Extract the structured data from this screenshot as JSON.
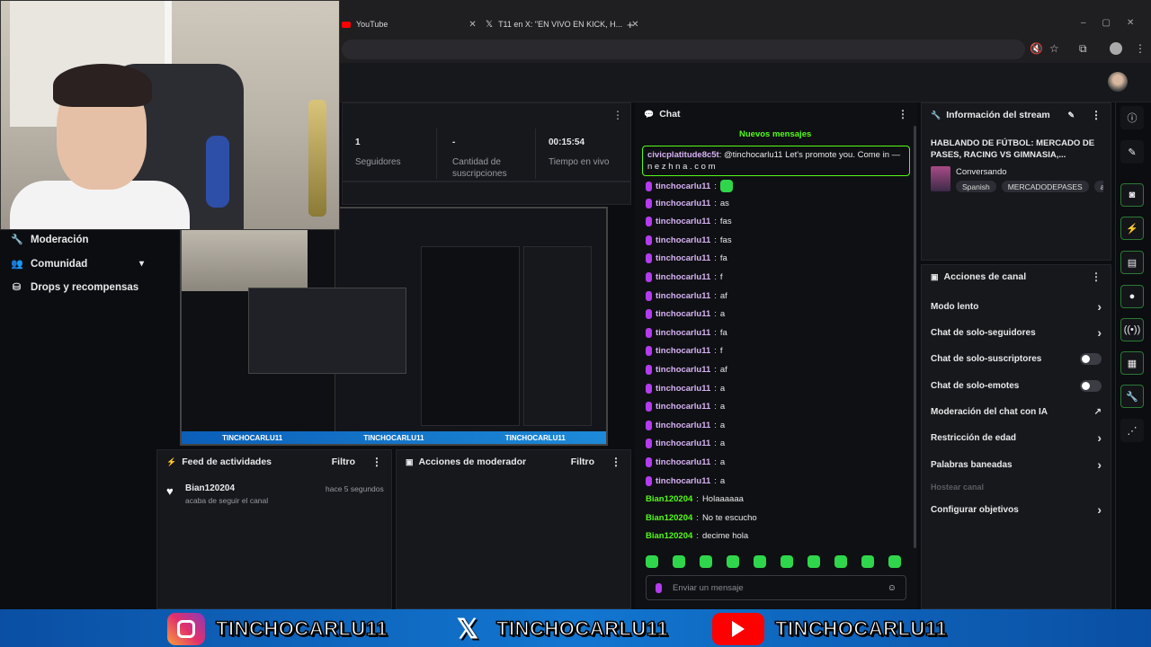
{
  "browser": {
    "tabs": [
      {
        "label": "YouTube"
      },
      {
        "label": "T11 en X: \"EN VIVO EN KICK, H..."
      }
    ],
    "new_tab": "+"
  },
  "stats": [
    {
      "value": "1",
      "label": "Seguidores"
    },
    {
      "value": "-",
      "label": "Cantidad de suscripciones"
    },
    {
      "value": "00:15:54",
      "label": "Tiempo en vivo"
    }
  ],
  "nav": [
    {
      "label": "Moderación",
      "icon": "wrench-icon"
    },
    {
      "label": "Comunidad",
      "icon": "people-icon"
    },
    {
      "label": "Drops y recompensas",
      "icon": "gift-icon"
    }
  ],
  "activity": {
    "title": "Feed de actividades",
    "filter": "Filtro",
    "user": "Bian120204",
    "action": "acaba de seguir el canal",
    "time": "hace 5 segundos"
  },
  "mod_actions": {
    "title": "Acciones de moderador",
    "filter": "Filtro"
  },
  "chat": {
    "title": "Chat",
    "new_messages": "Nuevos mensajes",
    "highlight_user": "civicplatitude8c5t",
    "highlight_text": "@tinchocarlu11 Let's promote you. Come in — n e z h n a . c o m",
    "messages": [
      {
        "user": "tinchocarlu11",
        "text": "",
        "emote": true
      },
      {
        "user": "tinchocarlu11",
        "text": "as"
      },
      {
        "user": "tinchocarlu11",
        "text": "fas"
      },
      {
        "user": "tinchocarlu11",
        "text": "fas"
      },
      {
        "user": "tinchocarlu11",
        "text": "fa"
      },
      {
        "user": "tinchocarlu11",
        "text": "f"
      },
      {
        "user": "tinchocarlu11",
        "text": "af"
      },
      {
        "user": "tinchocarlu11",
        "text": "a"
      },
      {
        "user": "tinchocarlu11",
        "text": "fa"
      },
      {
        "user": "tinchocarlu11",
        "text": "f"
      },
      {
        "user": "tinchocarlu11",
        "text": "af"
      },
      {
        "user": "tinchocarlu11",
        "text": "a"
      },
      {
        "user": "tinchocarlu11",
        "text": "a"
      },
      {
        "user": "tinchocarlu11",
        "text": "a"
      },
      {
        "user": "tinchocarlu11",
        "text": "a"
      },
      {
        "user": "tinchocarlu11",
        "text": "a"
      },
      {
        "user": "tinchocarlu11",
        "text": "a"
      },
      {
        "user": "Bian120204",
        "text": "Holaaaaaa",
        "guest": true
      },
      {
        "user": "Bian120204",
        "text": "No te escucho",
        "guest": true
      },
      {
        "user": "Bian120204",
        "text": "decime hola",
        "guest": true
      }
    ],
    "input_placeholder": "Enviar un mensaje"
  },
  "stream_info": {
    "title": "Información del stream",
    "stream_title": "HABLANDO DE FÚTBOL: MERCADO DE PASES, RACING VS GIMNASIA,...",
    "category": "Conversando",
    "tags": [
      "Spanish",
      "MERCADODEPASES",
      "arge"
    ]
  },
  "channel_actions": {
    "title": "Acciones de canal",
    "items": [
      {
        "label": "Modo lento",
        "control": "chevron"
      },
      {
        "label": "Chat de solo-seguidores",
        "control": "chevron"
      },
      {
        "label": "Chat de solo-suscriptores",
        "control": "toggle"
      },
      {
        "label": "Chat de solo-emotes",
        "control": "toggle"
      },
      {
        "label": "Moderación del chat con IA",
        "control": "external"
      },
      {
        "label": "Restricción de edad",
        "control": "chevron"
      },
      {
        "label": "Palabras baneadas",
        "control": "chevron"
      },
      {
        "label": "Hostear canal",
        "control": "none",
        "disabled": true
      },
      {
        "label": "Configurar objetivos",
        "control": "chevron"
      }
    ]
  },
  "banner": {
    "instagram": "TINCHOCARLU11",
    "x": "TINCHOCARLU11",
    "youtube": "TINCHOCARLU11"
  },
  "colors": {
    "accent": "#53fc18",
    "purple": "#b43cf0",
    "banner_blue": "#1276d0"
  }
}
